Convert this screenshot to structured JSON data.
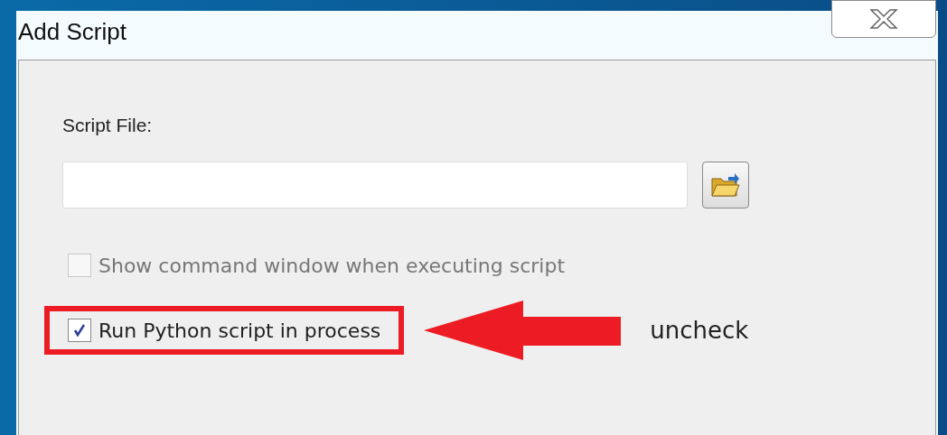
{
  "window": {
    "title": "Add Script"
  },
  "script_file": {
    "label": "Script File:"
  },
  "options": [
    {
      "label": "Show command window when executing script",
      "checked": false,
      "disabled": true,
      "highlighted": false
    },
    {
      "label": "Run Python script in process",
      "checked": true,
      "disabled": false,
      "highlighted": true
    }
  ],
  "annotation": {
    "text": "uncheck"
  }
}
